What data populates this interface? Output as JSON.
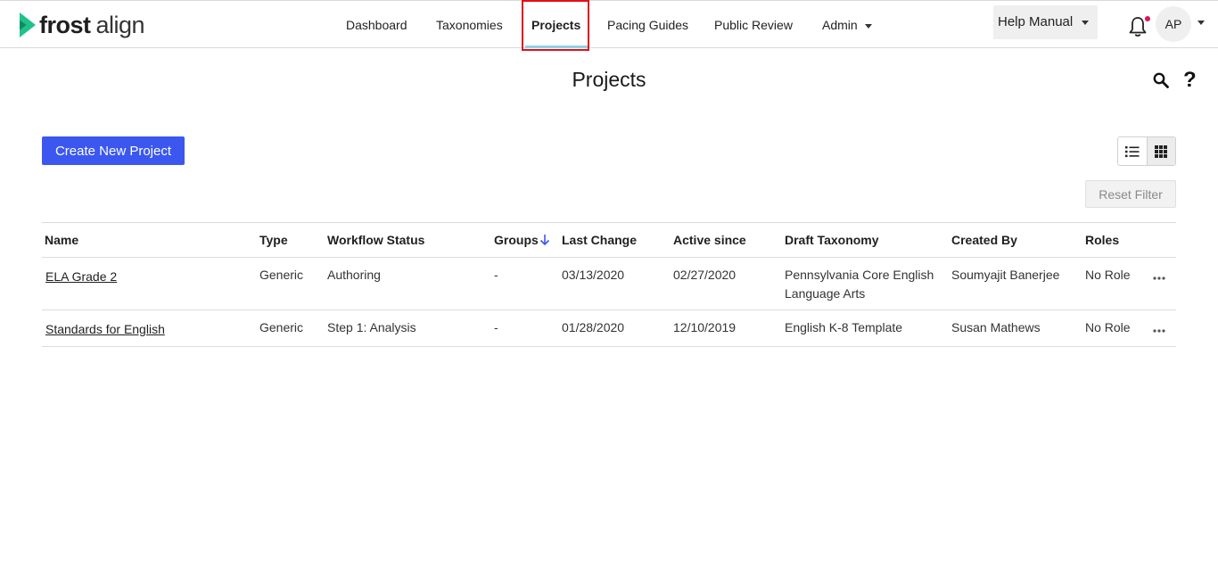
{
  "header": {
    "logo_text_bold": "frost",
    "logo_text_light": "align",
    "nav": [
      {
        "label": "Dashboard"
      },
      {
        "label": "Taxonomies"
      },
      {
        "label": "Projects"
      },
      {
        "label": "Pacing Guides"
      },
      {
        "label": "Public Review"
      },
      {
        "label": "Admin"
      }
    ],
    "help_label": "Help Manual",
    "avatar_initials": "AP"
  },
  "page": {
    "title": "Projects",
    "create_button": "Create New Project",
    "reset_filter": "Reset Filter"
  },
  "table": {
    "columns": [
      "Name",
      "Type",
      "Workflow Status",
      "Groups",
      "Last Change",
      "Active since",
      "Draft Taxonomy",
      "Created By",
      "Roles"
    ],
    "rows": [
      {
        "name": "ELA Grade 2",
        "type": "Generic",
        "workflow_status": "Authoring",
        "groups": "-",
        "last_change": "03/13/2020",
        "active_since": "02/27/2020",
        "draft_taxonomy_line1": "Pennsylvania Core English",
        "draft_taxonomy_line2": "Language Arts",
        "created_by": "Soumyajit Banerjee",
        "roles": "No Role"
      },
      {
        "name": "Standards for English",
        "type": "Generic",
        "workflow_status": "Step 1: Analysis",
        "groups": "-",
        "last_change": "01/28/2020",
        "active_since": "12/10/2019",
        "draft_taxonomy_line1": "English K-8 Template",
        "created_by": "Susan Mathews",
        "roles": "No Role"
      }
    ]
  },
  "colors": {
    "accent": "#3b57f0",
    "logo_green": "#1fc28b",
    "highlight_box": "#e0101a",
    "notification_dot": "#e0115f"
  },
  "icons": [
    "logo-chevron-icon",
    "bell-icon",
    "search-icon",
    "help-icon",
    "list-view-icon",
    "grid-view-icon",
    "sort-down-icon",
    "more-options-icon"
  ]
}
